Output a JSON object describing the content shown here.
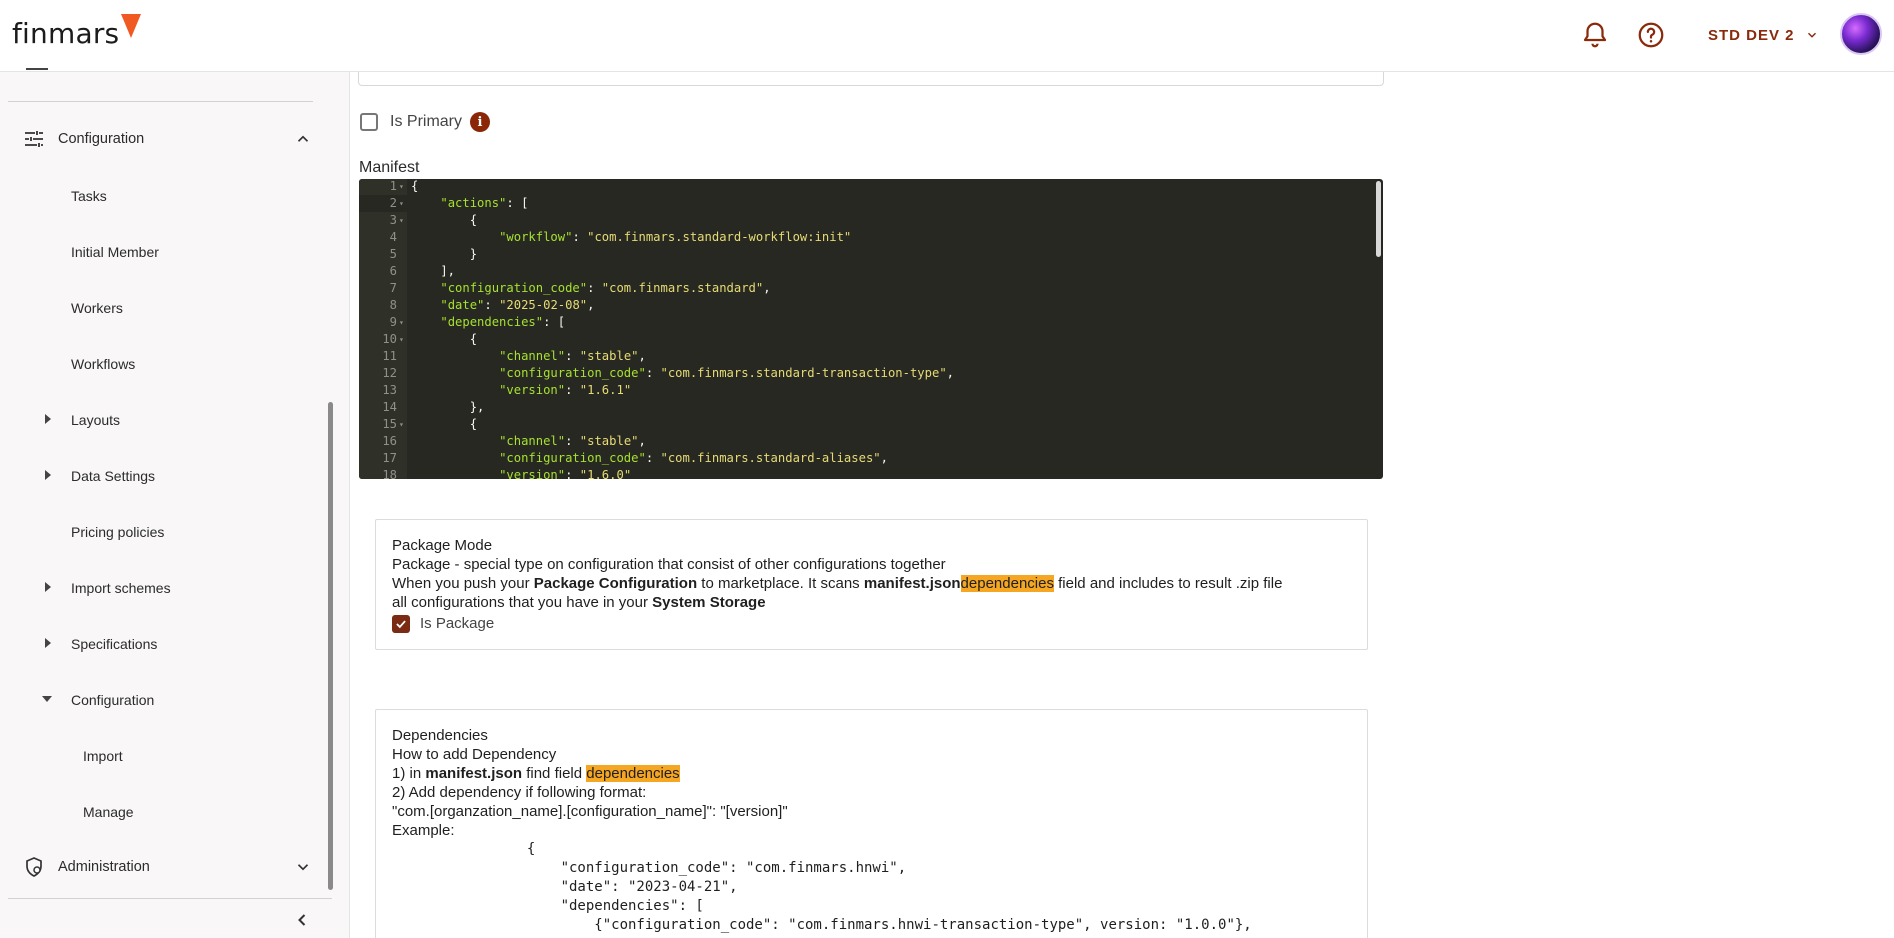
{
  "header": {
    "logo_text": "finmars",
    "workspace": "STD DEV 2",
    "icons": [
      "bell-icon",
      "help-icon",
      "chevron-down-icon"
    ],
    "accent": "#8a2a0c"
  },
  "sidebar": {
    "configuration_label": "Configuration",
    "items": [
      {
        "label": "Tasks"
      },
      {
        "label": "Initial Member"
      },
      {
        "label": "Workers"
      },
      {
        "label": "Workflows"
      },
      {
        "label": "Layouts"
      },
      {
        "label": "Data Settings"
      },
      {
        "label": "Pricing policies"
      },
      {
        "label": "Import schemes"
      },
      {
        "label": "Specifications"
      },
      {
        "label": "Configuration"
      },
      {
        "label": "Import"
      },
      {
        "label": "Manage"
      }
    ],
    "administration_label": "Administration"
  },
  "main": {
    "is_primary_label": "Is Primary",
    "is_primary_checked": false,
    "manifest_label": "Manifest",
    "editor_lines": [
      {
        "n": "1",
        "fold": true,
        "code": "{"
      },
      {
        "n": "2",
        "fold": true,
        "code": "    \"actions\": ["
      },
      {
        "n": "3",
        "fold": true,
        "code": "        {"
      },
      {
        "n": "4",
        "fold": false,
        "code": "            \"workflow\": \"com.finmars.standard-workflow:init\""
      },
      {
        "n": "5",
        "fold": false,
        "code": "        }"
      },
      {
        "n": "6",
        "fold": false,
        "code": "    ],"
      },
      {
        "n": "7",
        "fold": false,
        "code": "    \"configuration_code\": \"com.finmars.standard\","
      },
      {
        "n": "8",
        "fold": false,
        "code": "    \"date\": \"2025-02-08\","
      },
      {
        "n": "9",
        "fold": true,
        "code": "    \"dependencies\": ["
      },
      {
        "n": "10",
        "fold": true,
        "code": "        {"
      },
      {
        "n": "11",
        "fold": false,
        "code": "            \"channel\": \"stable\","
      },
      {
        "n": "12",
        "fold": false,
        "code": "            \"configuration_code\": \"com.finmars.standard-transaction-type\","
      },
      {
        "n": "13",
        "fold": false,
        "code": "            \"version\": \"1.6.1\""
      },
      {
        "n": "14",
        "fold": false,
        "code": "        },"
      },
      {
        "n": "15",
        "fold": true,
        "code": "        {"
      },
      {
        "n": "16",
        "fold": false,
        "code": "            \"channel\": \"stable\","
      },
      {
        "n": "17",
        "fold": false,
        "code": "            \"configuration_code\": \"com.finmars.standard-aliases\","
      },
      {
        "n": "18",
        "fold": false,
        "code": "            \"version\": \"1.6.0\""
      }
    ],
    "package_card": {
      "title": "Package Mode",
      "line1": "Package - special type on configuration that consist of other configurations together",
      "line2_a": "When you push your ",
      "line2_b": "Package Configuration",
      "line2_c": " to marketplace. It scans ",
      "line2_d": "manifest.json",
      "line2_e": "dependencies",
      "line2_f": " field and includes to result .zip file",
      "line3_a": "all configurations that you have in your ",
      "line3_b": "System Storage",
      "is_package_label": "Is Package",
      "is_package_checked": true
    },
    "deps_card": {
      "title": "Dependencies",
      "how": "How to add Dependency",
      "step1_a": "1) in ",
      "step1_b": "manifest.json",
      "step1_c": " find field ",
      "step1_d": "dependencies",
      "step2": "2) Add dependency if following format:",
      "format": "\"com.[organzation_name].[configuration_name]\": \"[version]\"",
      "example": "Example:",
      "code": "                {\n                    \"configuration_code\": \"com.finmars.hnwi\",\n                    \"date\": \"2023-04-21\",\n                    \"dependencies\": [\n                        {\"configuration_code\": \"com.finmars.hnwi-transaction-type\", version: \"1.0.0\"},"
    }
  }
}
